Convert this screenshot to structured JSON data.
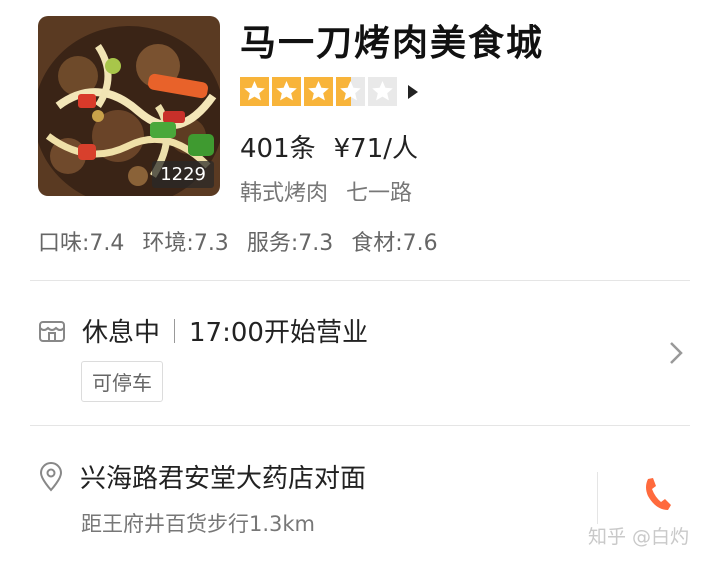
{
  "restaurant": {
    "name": "马一刀烤肉美食城",
    "photo_count": "1229",
    "rating_stars": 3.5,
    "review_count": "401条",
    "avg_price": "¥71/人",
    "cuisine": "韩式烤肉",
    "area": "七一路"
  },
  "scores": {
    "taste": "口味:7.4",
    "environment": "环境:7.3",
    "service": "服务:7.3",
    "ingredients": "食材:7.6"
  },
  "hours": {
    "status": "休息中",
    "opening": "17:00开始营业",
    "parking_tag": "可停车"
  },
  "location": {
    "address": "兴海路君安堂大药店对面",
    "distance": "距王府井百货步行1.3km"
  },
  "watermark": "知乎 @白灼",
  "colors": {
    "star_fill": "#f8b43a",
    "phone_icon": "#ff6a3d"
  },
  "icons": [
    "shop-hours-icon",
    "location-pin-icon",
    "chevron-right-icon",
    "phone-icon",
    "play-triangle-icon"
  ]
}
